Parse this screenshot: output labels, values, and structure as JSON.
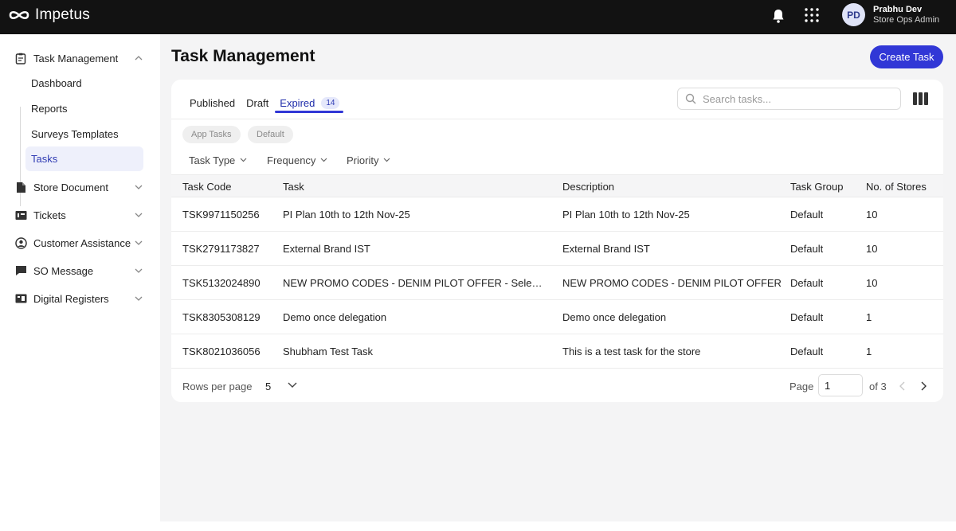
{
  "app": {
    "name": "Impetus",
    "user": {
      "initials": "PD",
      "name": "Prabhu Dev",
      "role": "Store Ops Admin"
    }
  },
  "sidebar": {
    "groups": [
      {
        "label": "Task Management",
        "icon": "clipboard-icon",
        "expanded": true,
        "items": [
          {
            "label": "Dashboard"
          },
          {
            "label": "Reports"
          },
          {
            "label": "Surveys Templates"
          },
          {
            "label": "Tasks",
            "active": true
          }
        ]
      },
      {
        "label": "Store Document",
        "icon": "document-icon"
      },
      {
        "label": "Tickets",
        "icon": "ticket-icon"
      },
      {
        "label": "Customer Assistance",
        "icon": "person-icon"
      },
      {
        "label": "SO Message",
        "icon": "message-icon"
      },
      {
        "label": "Digital Registers",
        "icon": "register-icon"
      }
    ]
  },
  "main": {
    "title": "Task Management",
    "create_button": "Create Task",
    "tabs": [
      {
        "label": "Published"
      },
      {
        "label": "Draft"
      },
      {
        "label": "Expired",
        "badge": "14",
        "active": true
      }
    ],
    "search": {
      "placeholder": "Search tasks...",
      "value": ""
    },
    "chips": [
      "App Tasks",
      "Default"
    ],
    "filters": [
      "Task Type",
      "Frequency",
      "Priority"
    ],
    "table": {
      "columns": [
        "Task Code",
        "Task",
        "Description",
        "Task Group",
        "No. of Stores"
      ],
      "rows": [
        [
          "TSK9971150256",
          "PI Plan 10th to 12th Nov-25",
          "PI Plan 10th to 12th Nov-25",
          "Default",
          "10"
        ],
        [
          "TSK2791173827",
          "External Brand IST",
          "External Brand IST",
          "Default",
          "10"
        ],
        [
          "TSK5132024890",
          "NEW PROMO CODES - DENIM PILOT OFFER - Select...",
          "NEW PROMO CODES - DENIM PILOT OFFER",
          "Default",
          "10"
        ],
        [
          "TSK8305308129",
          "Demo once delegation",
          "Demo once delegation",
          "Default",
          "1"
        ],
        [
          "TSK8021036056",
          "Shubham Test Task",
          "This is a test task for the store",
          "Default",
          "1"
        ]
      ]
    },
    "pagination": {
      "rows_per_page_label": "Rows per page",
      "rows_per_page": "5",
      "page_label": "Page",
      "page": "1",
      "of_label": "of 3"
    }
  },
  "colors": {
    "accent": "#3137d6",
    "topbar": "#121212",
    "active_bg": "#eef0fb"
  }
}
